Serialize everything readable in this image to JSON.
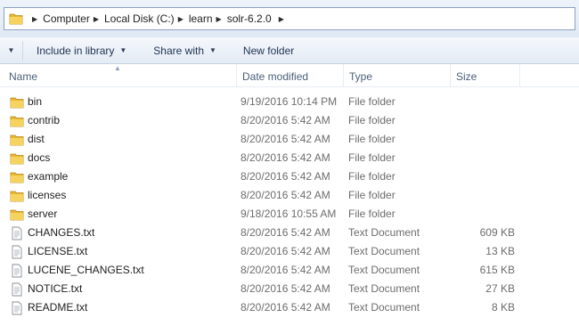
{
  "address": {
    "crumbs": [
      "Computer",
      "Local Disk (C:)",
      "learn",
      "solr-6.2.0"
    ]
  },
  "toolbar": {
    "include_label": "Include in library",
    "share_label": "Share with",
    "newfolder_label": "New folder"
  },
  "columns": {
    "name": "Name",
    "date": "Date modified",
    "type": "Type",
    "size": "Size"
  },
  "files": [
    {
      "name": "bin",
      "date": "9/19/2016 10:14 PM",
      "type": "File folder",
      "size": "",
      "icon": "folder-icon"
    },
    {
      "name": "contrib",
      "date": "8/20/2016 5:42 AM",
      "type": "File folder",
      "size": "",
      "icon": "folder-icon"
    },
    {
      "name": "dist",
      "date": "8/20/2016 5:42 AM",
      "type": "File folder",
      "size": "",
      "icon": "folder-icon"
    },
    {
      "name": "docs",
      "date": "8/20/2016 5:42 AM",
      "type": "File folder",
      "size": "",
      "icon": "folder-icon"
    },
    {
      "name": "example",
      "date": "8/20/2016 5:42 AM",
      "type": "File folder",
      "size": "",
      "icon": "folder-icon"
    },
    {
      "name": "licenses",
      "date": "8/20/2016 5:42 AM",
      "type": "File folder",
      "size": "",
      "icon": "folder-icon"
    },
    {
      "name": "server",
      "date": "9/18/2016 10:55 AM",
      "type": "File folder",
      "size": "",
      "icon": "folder-icon"
    },
    {
      "name": "CHANGES.txt",
      "date": "8/20/2016 5:42 AM",
      "type": "Text Document",
      "size": "609 KB",
      "icon": "text-file-icon"
    },
    {
      "name": "LICENSE.txt",
      "date": "8/20/2016 5:42 AM",
      "type": "Text Document",
      "size": "13 KB",
      "icon": "text-file-icon"
    },
    {
      "name": "LUCENE_CHANGES.txt",
      "date": "8/20/2016 5:42 AM",
      "type": "Text Document",
      "size": "615 KB",
      "icon": "text-file-icon"
    },
    {
      "name": "NOTICE.txt",
      "date": "8/20/2016 5:42 AM",
      "type": "Text Document",
      "size": "27 KB",
      "icon": "text-file-icon"
    },
    {
      "name": "README.txt",
      "date": "8/20/2016 5:42 AM",
      "type": "Text Document",
      "size": "8 KB",
      "icon": "text-file-icon"
    }
  ]
}
